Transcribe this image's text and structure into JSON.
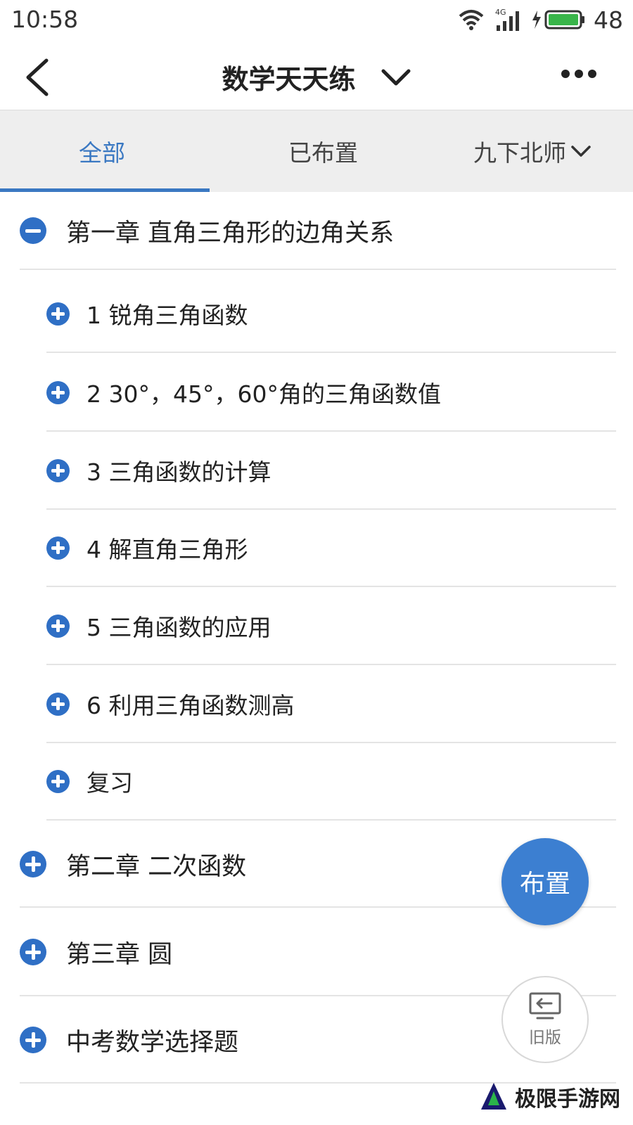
{
  "status": {
    "time": "10:58",
    "network": "4G",
    "battery": "48"
  },
  "header": {
    "title": "数学天天练"
  },
  "tabs": {
    "all": "全部",
    "assigned": "已布置",
    "book": "九下北师"
  },
  "chapters": [
    {
      "label": "第一章 直角三角形的边角关系",
      "expanded": true,
      "sections": [
        "1 锐角三角函数",
        "2 30°，45°，60°角的三角函数值",
        "3 三角函数的计算",
        "4 解直角三角形",
        "5 三角函数的应用",
        "6 利用三角函数测高",
        "复习"
      ]
    },
    {
      "label": "第二章 二次函数",
      "expanded": false
    },
    {
      "label": "第三章 圆",
      "expanded": false
    },
    {
      "label": "中考数学选择题",
      "expanded": false
    }
  ],
  "fab": {
    "assign": "布置",
    "old_version": "旧版"
  },
  "watermark": {
    "text": "极限手游网"
  },
  "colors": {
    "accent": "#3a78c2",
    "icon": "#2f6fc5",
    "tab_bg": "#eeeeee"
  }
}
